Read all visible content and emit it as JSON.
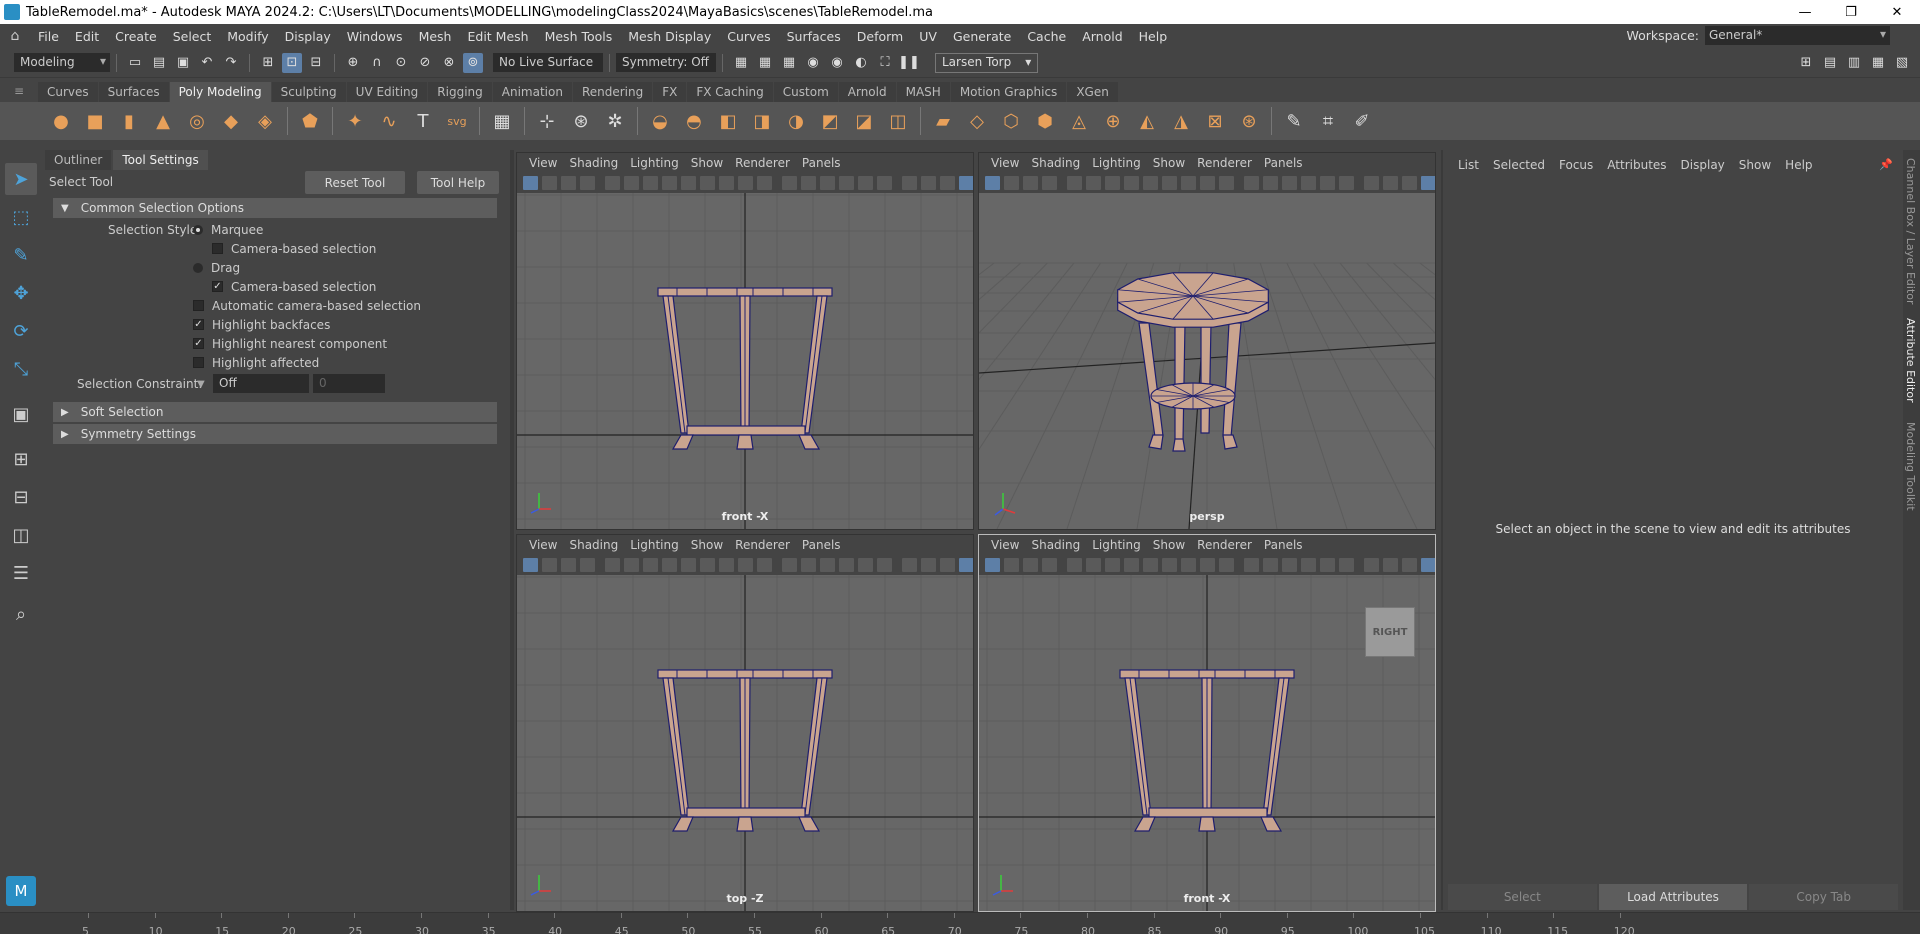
{
  "window": {
    "title": "TableRemodel.ma* - Autodesk MAYA 2024.2: C:\\Users\\LT\\Documents\\MODELLING\\modelingClass2024\\MayaBasics\\scenes\\TableRemodel.ma",
    "minimize": "—",
    "maximize": "❐",
    "close": "✕"
  },
  "menubar": {
    "items": [
      "File",
      "Edit",
      "Create",
      "Select",
      "Modify",
      "Display",
      "Windows",
      "Mesh",
      "Edit Mesh",
      "Mesh Tools",
      "Mesh Display",
      "Curves",
      "Surfaces",
      "Deform",
      "UV",
      "Generate",
      "Cache",
      "Arnold",
      "Help"
    ],
    "workspace_label": "Workspace:",
    "workspace_value": "General*"
  },
  "statusline": {
    "menuset": "Modeling",
    "live_surface": "No Live Surface",
    "symmetry": "Symmetry: Off",
    "user": "Larsen Torp"
  },
  "shelf": {
    "tabs": [
      "Curves",
      "Surfaces",
      "Poly Modeling",
      "Sculpting",
      "UV Editing",
      "Rigging",
      "Animation",
      "Rendering",
      "FX",
      "FX Caching",
      "Custom",
      "Arnold",
      "MASH",
      "Motion Graphics",
      "XGen"
    ],
    "active_tab": "Poly Modeling",
    "text_tool_glyph": "T",
    "svg_tool_label": "svg"
  },
  "toolsettings": {
    "tabs": [
      "Outliner",
      "Tool Settings"
    ],
    "active_tab": "Tool Settings",
    "tool_name": "Select Tool",
    "reset_button": "Reset Tool",
    "help_button": "Tool Help",
    "common_section": "Common Selection Options",
    "selection_style_label": "Selection Style:",
    "marquee": "Marquee",
    "camera_based_1": "Camera-based selection",
    "drag": "Drag",
    "camera_based_2": "Camera-based selection",
    "auto_camera": "Automatic camera-based selection",
    "highlight_backfaces": "Highlight backfaces",
    "highlight_nearest": "Highlight nearest component",
    "highlight_affected": "Highlight affected",
    "constraint_label": "Selection Constraint:",
    "constraint_value": "Off",
    "constraint_num": "0",
    "soft_selection": "Soft Selection",
    "symmetry_settings": "Symmetry Settings",
    "checks": {
      "camera_based_1": false,
      "camera_based_2": true,
      "auto_camera": false,
      "highlight_backfaces": true,
      "highlight_nearest": true,
      "highlight_affected": false
    },
    "selected_style": "Marquee"
  },
  "viewports": {
    "menu": [
      "View",
      "Shading",
      "Lighting",
      "Show",
      "Renderer",
      "Panels"
    ],
    "labels": [
      "front -X",
      "persp",
      "top -Z",
      "front -X"
    ],
    "cube_label": "RIGHT"
  },
  "attribute_editor": {
    "menu": [
      "List",
      "Selected",
      "Focus",
      "Attributes",
      "Display",
      "Show",
      "Help"
    ],
    "message": "Select an object in the scene to view and edit its attributes",
    "buttons": [
      "Select",
      "Load Attributes",
      "Copy Tab"
    ]
  },
  "side_tabs": [
    "Channel Box / Layer Editor",
    "Attribute Editor",
    "Modeling Toolkit"
  ],
  "timeslider": {
    "ticks": [
      "5",
      "10",
      "15",
      "20",
      "25",
      "30",
      "35",
      "40",
      "45",
      "50",
      "55",
      "60",
      "65",
      "70",
      "75",
      "80",
      "85",
      "90",
      "95",
      "100",
      "105",
      "110",
      "115",
      "120"
    ]
  },
  "colors": {
    "accent": "#5d7fa7",
    "maya_blue": "#2a8fc4",
    "mesh_fill": "#c9a48f",
    "wire": "#1e1e6e"
  }
}
